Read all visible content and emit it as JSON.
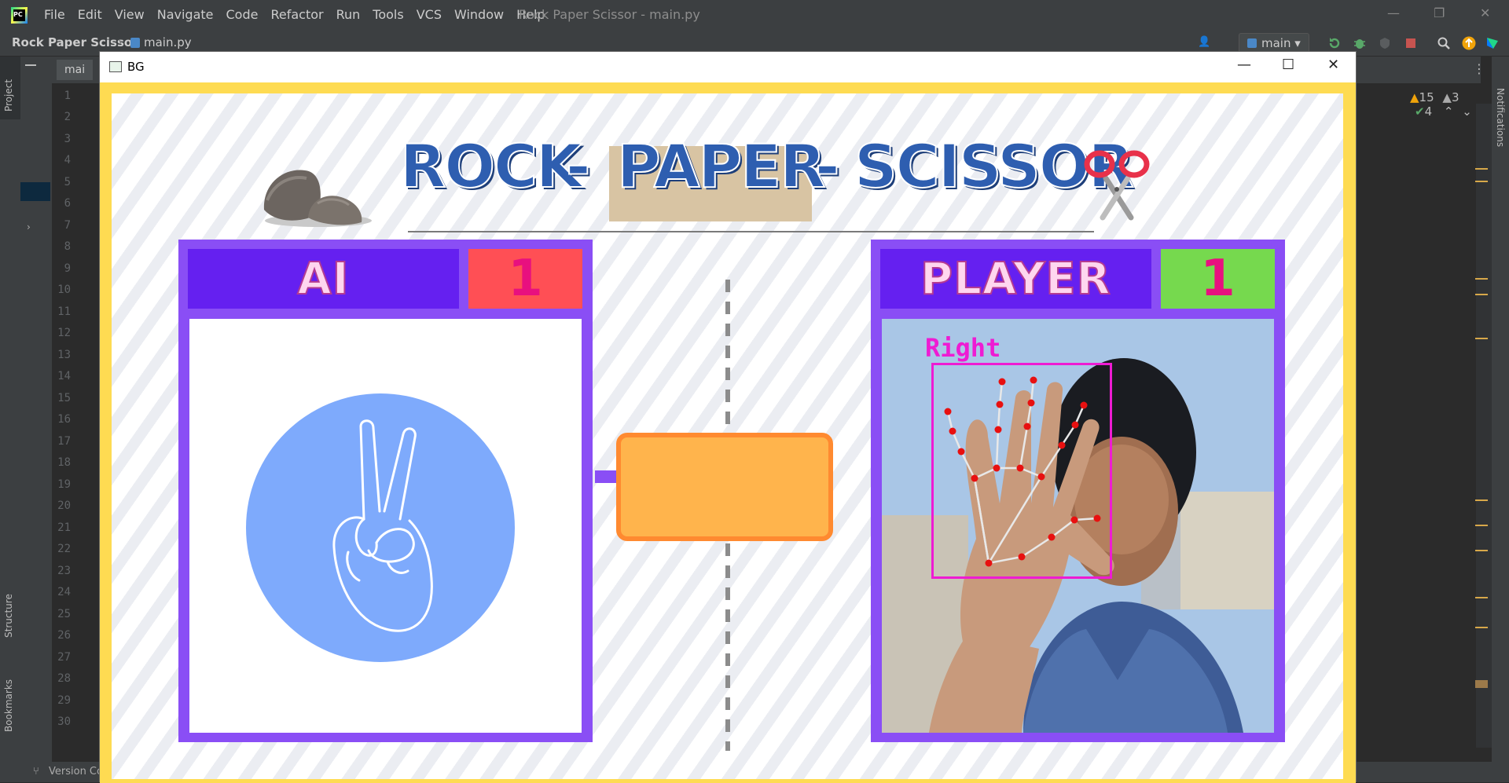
{
  "ide": {
    "menu": [
      "File",
      "Edit",
      "View",
      "Navigate",
      "Code",
      "Refactor",
      "Run",
      "Tools",
      "VCS",
      "Window",
      "Help"
    ],
    "window_title": "Rock Paper Scissor - main.py",
    "project_name": "Rock Paper Scissor",
    "current_file": "main.py",
    "editor_tab": "mai",
    "branch": "main",
    "inspections": {
      "warnings": "15",
      "weak_warnings": "3",
      "ok": "4"
    },
    "line_numbers": [
      "1",
      "2",
      "3",
      "4",
      "5",
      "6",
      "7",
      "8",
      "9",
      "10",
      "11",
      "12",
      "13",
      "14",
      "15",
      "16",
      "17",
      "18",
      "19",
      "20",
      "21",
      "22",
      "23",
      "24",
      "25",
      "26",
      "27",
      "28",
      "29",
      "30"
    ],
    "left_tool_windows": [
      "Project",
      "Structure",
      "Bookmarks"
    ],
    "right_tool_windows": [
      "Notifications"
    ],
    "status_left": "Version Co"
  },
  "bg_window": {
    "title": "BG",
    "game": {
      "title_words": [
        "ROCK",
        "-",
        "PAPER",
        "-",
        "SCISSOR"
      ],
      "ai": {
        "label": "AI",
        "score": "1",
        "score_color": "#ff4f55",
        "move_icon": "peace-hand-icon",
        "circle_color": "#7eaafc"
      },
      "player": {
        "label": "PLAYER",
        "score": "1",
        "score_color": "#76d94e",
        "hand_label": "Right",
        "detection_color": "#ee1bd3"
      },
      "result": ""
    }
  },
  "colors": {
    "frame": "#fedb52",
    "panel": "#8a4ef5",
    "label_bg": "#6520f0",
    "result_fill": "#ffb44c",
    "result_border": "#ff8a30",
    "title_blue": "#2e5eb0"
  }
}
